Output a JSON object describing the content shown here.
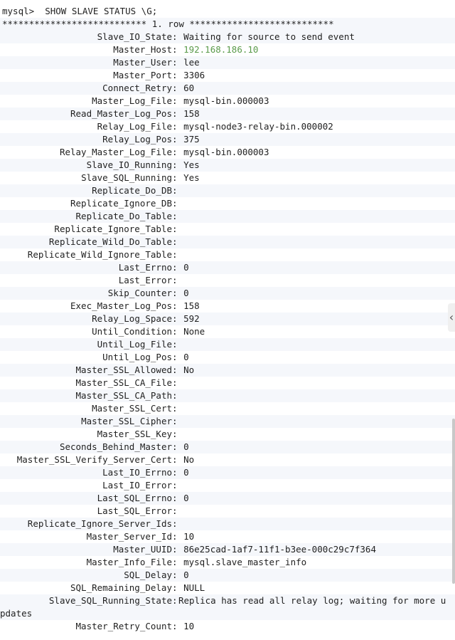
{
  "prompt_line": "mysql>  SHOW SLAVE STATUS \\G;",
  "row_header": "*************************** 1. row ***************************",
  "fields": [
    {
      "name": "Slave_IO_State",
      "value": "Waiting for source to send event"
    },
    {
      "name": "Master_Host",
      "value": "192.168.186.10"
    },
    {
      "name": "Master_User",
      "value": "lee"
    },
    {
      "name": "Master_Port",
      "value": "3306"
    },
    {
      "name": "Connect_Retry",
      "value": "60"
    },
    {
      "name": "Master_Log_File",
      "value": "mysql-bin.000003"
    },
    {
      "name": "Read_Master_Log_Pos",
      "value": "158"
    },
    {
      "name": "Relay_Log_File",
      "value": "mysql-node3-relay-bin.000002"
    },
    {
      "name": "Relay_Log_Pos",
      "value": "375"
    },
    {
      "name": "Relay_Master_Log_File",
      "value": "mysql-bin.000003"
    },
    {
      "name": "Slave_IO_Running",
      "value": "Yes"
    },
    {
      "name": "Slave_SQL_Running",
      "value": "Yes"
    },
    {
      "name": "Replicate_Do_DB",
      "value": ""
    },
    {
      "name": "Replicate_Ignore_DB",
      "value": ""
    },
    {
      "name": "Replicate_Do_Table",
      "value": ""
    },
    {
      "name": "Replicate_Ignore_Table",
      "value": ""
    },
    {
      "name": "Replicate_Wild_Do_Table",
      "value": ""
    },
    {
      "name": "Replicate_Wild_Ignore_Table",
      "value": ""
    },
    {
      "name": "Last_Errno",
      "value": "0"
    },
    {
      "name": "Last_Error",
      "value": ""
    },
    {
      "name": "Skip_Counter",
      "value": "0"
    },
    {
      "name": "Exec_Master_Log_Pos",
      "value": "158"
    },
    {
      "name": "Relay_Log_Space",
      "value": "592"
    },
    {
      "name": "Until_Condition",
      "value": "None"
    },
    {
      "name": "Until_Log_File",
      "value": ""
    },
    {
      "name": "Until_Log_Pos",
      "value": "0"
    },
    {
      "name": "Master_SSL_Allowed",
      "value": "No"
    },
    {
      "name": "Master_SSL_CA_File",
      "value": ""
    },
    {
      "name": "Master_SSL_CA_Path",
      "value": ""
    },
    {
      "name": "Master_SSL_Cert",
      "value": ""
    },
    {
      "name": "Master_SSL_Cipher",
      "value": ""
    },
    {
      "name": "Master_SSL_Key",
      "value": ""
    },
    {
      "name": "Seconds_Behind_Master",
      "value": "0"
    },
    {
      "name": "Master_SSL_Verify_Server_Cert",
      "value": "No"
    },
    {
      "name": "Last_IO_Errno",
      "value": "0"
    },
    {
      "name": "Last_IO_Error",
      "value": ""
    },
    {
      "name": "Last_SQL_Errno",
      "value": "0"
    },
    {
      "name": "Last_SQL_Error",
      "value": ""
    },
    {
      "name": "Replicate_Ignore_Server_Ids",
      "value": ""
    },
    {
      "name": "Master_Server_Id",
      "value": "10"
    },
    {
      "name": "Master_UUID",
      "value": "86e25cad-1af7-11f1-b3ee-000c29c7f364"
    },
    {
      "name": "Master_Info_File",
      "value": "mysql.slave_master_info"
    },
    {
      "name": "SQL_Delay",
      "value": "0"
    },
    {
      "name": "SQL_Remaining_Delay",
      "value": "NULL"
    },
    {
      "name": "Slave_SQL_Running_State",
      "value": "Replica has read all relay log; waiting for more updates"
    },
    {
      "name": "Master_Retry_Count",
      "value": "10"
    }
  ],
  "highlight_color": "#5a9a4a",
  "collapse_handle_icon": "chevron-left-icon",
  "collapse_handle_glyph": "‹"
}
